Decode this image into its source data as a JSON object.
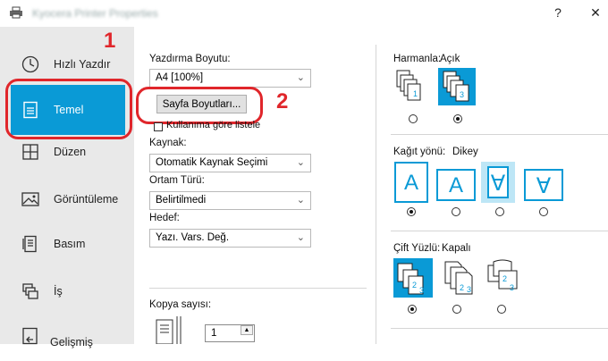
{
  "window": {
    "title": "Kyocera Printer Properties",
    "help_label": "?",
    "close_label": "✕"
  },
  "sidebar": {
    "items": [
      {
        "label": "Hızlı Yazdır"
      },
      {
        "label": "Temel"
      },
      {
        "label": "Düzen"
      },
      {
        "label": "Görüntüleme"
      },
      {
        "label": "Basım"
      },
      {
        "label": "İş"
      },
      {
        "label": "Gelişmiş"
      }
    ]
  },
  "callouts": {
    "one": "1",
    "two": "2"
  },
  "basic": {
    "print_size_label": "Yazdırma Boyutu:",
    "print_size_value": "A4  [100%]",
    "page_sizes_button": "Sayfa Boyutları...",
    "list_by_usage_label": "Kullanıma göre listele",
    "source_label": "Kaynak:",
    "source_value": "Otomatik Kaynak Seçimi",
    "media_label": "Ortam Türü:",
    "media_value": "Belirtilmedi",
    "dest_label": "Hedef:",
    "dest_value": "Yazı. Vars. Değ.",
    "copies_label": "Kopya sayısı:",
    "copies_value": "1"
  },
  "right": {
    "collate_label": "Harmanla:",
    "collate_value": "Açık",
    "orientation_label": "Kağıt yönü:",
    "orientation_value": "Dikey",
    "duplex_label": "Çift Yüzlü:",
    "duplex_value": "Kapalı",
    "orient_glyphs": [
      "A",
      "A",
      "∀",
      "∀"
    ]
  },
  "colors": {
    "accent": "#0a9ad6",
    "callout": "#e0262b"
  }
}
